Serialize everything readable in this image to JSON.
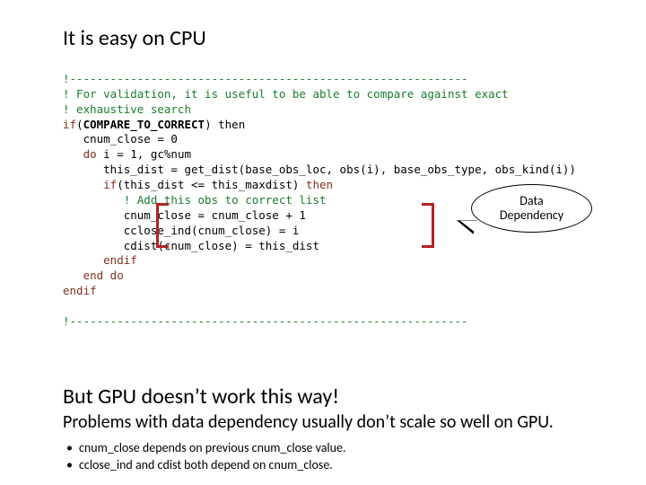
{
  "title": "It is easy on CPU",
  "code": {
    "l1": "!-----------------------------------------------------------",
    "l2": "! For validation, it is useful to be able to compare against exact",
    "l3": "! exhaustive search",
    "l4a": "if",
    "l4b": "(",
    "l4c": "COMPARE_TO_CORRECT",
    "l4d": ") then",
    "l5": "   cnum_close = 0",
    "l6a": "   do",
    "l6b": " i = 1, gc%num",
    "l7": "      this_dist = get_dist(base_obs_loc, obs(i), base_obs_type, obs_kind(i))",
    "l8a": "      if",
    "l8b": "(this_dist <= this_maxdist) ",
    "l8c": "then",
    "l9": "         ! Add this obs to correct list",
    "l10": "         cnum_close = cnum_close + 1",
    "l11": "         cclose_ind(cnum_close) = i",
    "l12": "         cdist(cnum_close) = this_dist",
    "l13": "      endif",
    "l14": "   end do",
    "l15": "endif",
    "l16": "",
    "l17": "!-----------------------------------------------------------"
  },
  "callout": "Data\nDependency",
  "subtitle": "But GPU doesn’t work this way!",
  "body": "Problems with data dependency usually don’t scale so well on GPU.",
  "bullets": [
    "cnum_close depends on previous cnum_close value.",
    "cclose_ind and cdist both depend on cnum_close."
  ]
}
